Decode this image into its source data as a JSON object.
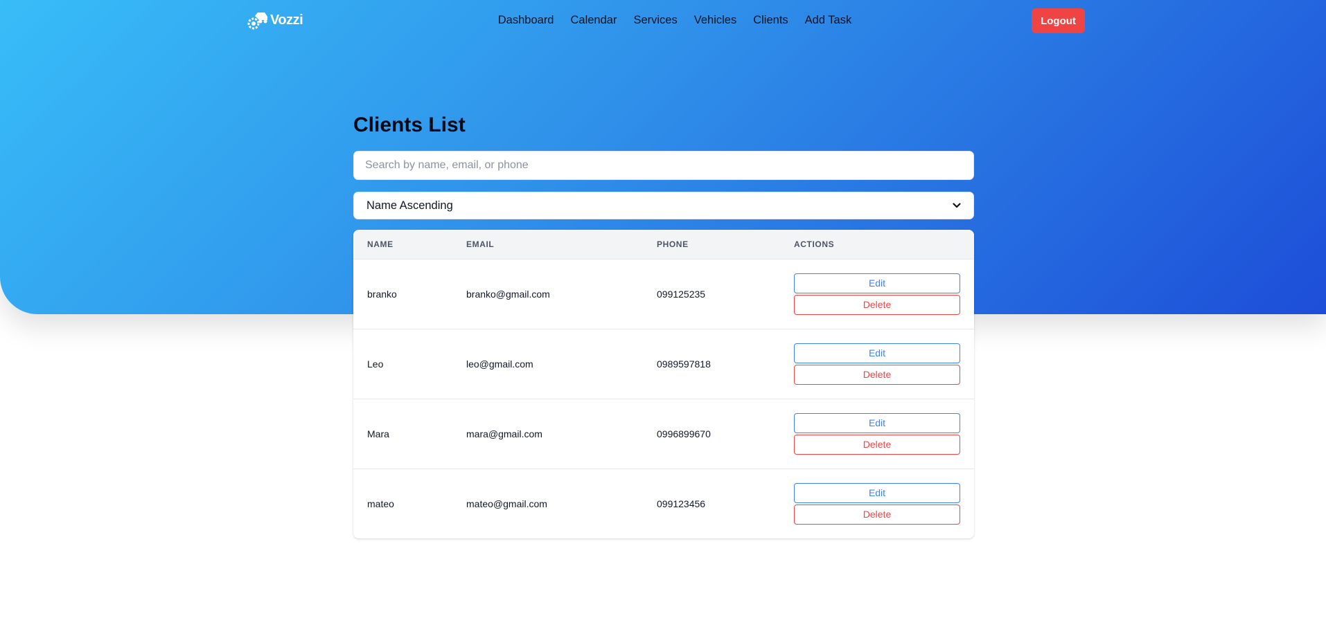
{
  "brand": {
    "name": "Vozzi",
    "icon": "car-gear-logo-icon"
  },
  "nav": {
    "links": [
      "Dashboard",
      "Calendar",
      "Services",
      "Vehicles",
      "Clients",
      "Add Task"
    ],
    "logout_label": "Logout"
  },
  "page": {
    "title": "Clients List",
    "search_placeholder": "Search by name, email, or phone",
    "search_value": "",
    "sort_value": "Name Ascending"
  },
  "table": {
    "headers": [
      "NAME",
      "EMAIL",
      "PHONE",
      "ACTIONS"
    ],
    "edit_label": "Edit",
    "delete_label": "Delete",
    "rows": [
      {
        "name": "branko",
        "email": "branko@gmail.com",
        "phone": "099125235"
      },
      {
        "name": "Leo",
        "email": "leo@gmail.com",
        "phone": "0989597818"
      },
      {
        "name": "Mara",
        "email": "mara@gmail.com",
        "phone": "0996899670"
      },
      {
        "name": "mateo",
        "email": "mateo@gmail.com",
        "phone": "099123456"
      }
    ]
  },
  "colors": {
    "gradient_start": "#38bdf8",
    "gradient_end": "#1d4ed8",
    "logout": "#ef4444",
    "edit": "#3b82f6",
    "delete": "#ef4444"
  }
}
